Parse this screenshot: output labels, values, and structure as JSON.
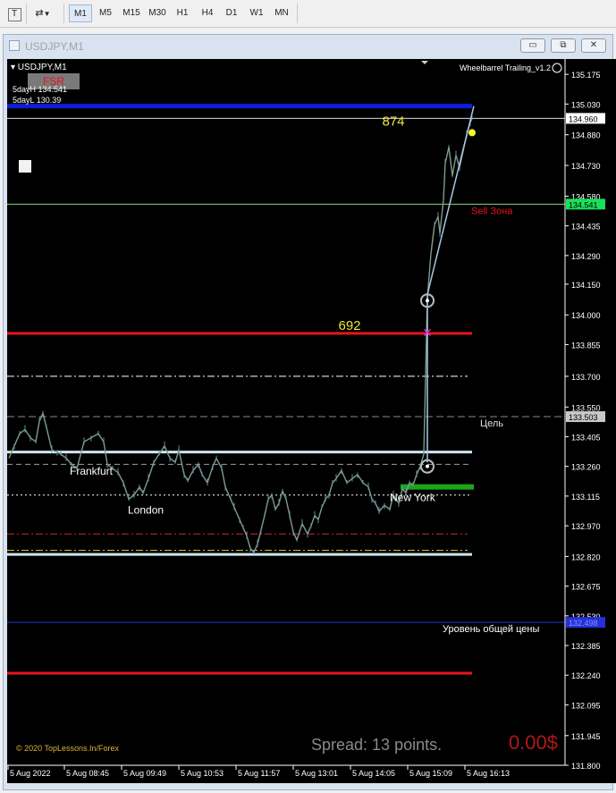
{
  "toolbar": {
    "timeframes": [
      "M1",
      "M5",
      "M15",
      "M30",
      "H1",
      "H4",
      "D1",
      "W1",
      "MN"
    ],
    "active_timeframe": "M1"
  },
  "window": {
    "title": "USDJPY,M1",
    "minimize": "▭",
    "restore": "⧉",
    "close": "✕"
  },
  "chart_header": {
    "symbol": "USDJPY,M1",
    "fsr": "FSR",
    "day_high": "5dayH 134.541",
    "day_low": "5dayL 130.39",
    "indicator": "Wheelbarrel Trailing_v1.2"
  },
  "labels": {
    "top_count": "874",
    "mid_count": "692",
    "sell_zone": "Sell Зона",
    "target": "Цель",
    "total_price": "Уровень общей цены",
    "session_frankfurt": "Frankfurt",
    "session_london": "London",
    "session_newyork": "New York",
    "copyright": "© 2020 TopLessons.In/Forex",
    "spread": "Spread: 13 points.",
    "profit": "0.00$"
  },
  "price_tags": {
    "current": "134.960",
    "sell_zone": "134.541",
    "target": "133.503",
    "total_price": "132.498"
  },
  "colors": {
    "accent_red": "#e8141b",
    "accent_blue": "#0b1fd6",
    "price_green": "#19e05a",
    "bar_color": "#7f9c8a",
    "line_color": "#a8c8e8"
  },
  "chart_data": {
    "type": "line",
    "symbol": "USDJPY",
    "timeframe": "M1",
    "y_axis_ticks": [
      "135.175",
      "135.030",
      "134.880",
      "134.730",
      "134.580",
      "134.435",
      "134.290",
      "134.150",
      "134.000",
      "133.855",
      "133.700",
      "133.550",
      "133.405",
      "133.260",
      "133.115",
      "132.970",
      "132.820",
      "132.675",
      "132.530",
      "132.385",
      "132.240",
      "132.095",
      "131.945",
      "131.800"
    ],
    "x_axis_ticks": [
      "5 Aug 2022",
      "5 Aug 08:45",
      "5 Aug 09:49",
      "5 Aug 10:53",
      "5 Aug 11:57",
      "5 Aug 13:01",
      "5 Aug 14:05",
      "5 Aug 15:09",
      "5 Aug 16:13"
    ],
    "ylim": [
      131.8,
      135.25
    ],
    "price_series": [
      [
        0,
        133.3
      ],
      [
        6,
        133.36
      ],
      [
        12,
        133.42
      ],
      [
        18,
        133.44
      ],
      [
        24,
        133.4
      ],
      [
        30,
        133.38
      ],
      [
        34,
        133.48
      ],
      [
        38,
        133.52
      ],
      [
        42,
        133.45
      ],
      [
        48,
        133.34
      ],
      [
        54,
        133.33
      ],
      [
        58,
        133.32
      ],
      [
        64,
        133.3
      ],
      [
        70,
        133.27
      ],
      [
        76,
        133.25
      ],
      [
        84,
        133.38
      ],
      [
        92,
        133.4
      ],
      [
        100,
        133.42
      ],
      [
        106,
        133.38
      ],
      [
        110,
        133.27
      ],
      [
        116,
        133.25
      ],
      [
        122,
        133.23
      ],
      [
        128,
        133.18
      ],
      [
        134,
        133.1
      ],
      [
        140,
        133.12
      ],
      [
        146,
        133.16
      ],
      [
        150,
        133.13
      ],
      [
        156,
        133.2
      ],
      [
        162,
        133.28
      ],
      [
        168,
        133.32
      ],
      [
        174,
        133.36
      ],
      [
        180,
        133.3
      ],
      [
        186,
        133.28
      ],
      [
        190,
        133.34
      ],
      [
        196,
        133.22
      ],
      [
        200,
        133.19
      ],
      [
        206,
        133.24
      ],
      [
        212,
        133.27
      ],
      [
        216,
        133.22
      ],
      [
        222,
        133.18
      ],
      [
        228,
        133.26
      ],
      [
        232,
        133.3
      ],
      [
        238,
        133.25
      ],
      [
        242,
        133.16
      ],
      [
        248,
        133.1
      ],
      [
        252,
        133.06
      ],
      [
        258,
        133.0
      ],
      [
        262,
        132.96
      ],
      [
        266,
        132.92
      ],
      [
        270,
        132.86
      ],
      [
        274,
        132.84
      ],
      [
        278,
        132.88
      ],
      [
        282,
        132.95
      ],
      [
        286,
        133.02
      ],
      [
        290,
        133.1
      ],
      [
        294,
        133.12
      ],
      [
        298,
        133.05
      ],
      [
        302,
        133.08
      ],
      [
        306,
        133.14
      ],
      [
        310,
        133.1
      ],
      [
        314,
        133.02
      ],
      [
        318,
        132.94
      ],
      [
        322,
        132.9
      ],
      [
        328,
        132.98
      ],
      [
        334,
        132.93
      ],
      [
        338,
        132.97
      ],
      [
        342,
        133.02
      ],
      [
        346,
        133.0
      ],
      [
        350,
        133.06
      ],
      [
        354,
        133.1
      ],
      [
        358,
        133.12
      ],
      [
        362,
        133.18
      ],
      [
        366,
        133.2
      ],
      [
        372,
        133.24
      ],
      [
        378,
        133.18
      ],
      [
        384,
        133.2
      ],
      [
        390,
        133.22
      ],
      [
        396,
        133.18
      ],
      [
        402,
        133.16
      ],
      [
        406,
        133.1
      ],
      [
        410,
        133.08
      ],
      [
        414,
        133.04
      ],
      [
        420,
        133.07
      ],
      [
        426,
        133.05
      ],
      [
        430,
        133.12
      ],
      [
        436,
        133.08
      ],
      [
        440,
        133.15
      ],
      [
        444,
        133.13
      ],
      [
        448,
        133.18
      ],
      [
        452,
        133.17
      ],
      [
        456,
        133.22
      ],
      [
        460,
        133.26
      ],
      [
        464,
        133.32
      ],
      [
        468,
        134.08
      ],
      [
        472,
        134.3
      ],
      [
        476,
        134.44
      ],
      [
        480,
        134.48
      ],
      [
        482,
        134.4
      ],
      [
        486,
        134.56
      ],
      [
        488,
        134.74
      ],
      [
        492,
        134.82
      ],
      [
        496,
        134.68
      ],
      [
        500,
        134.78
      ],
      [
        504,
        134.72
      ],
      [
        508,
        134.8
      ],
      [
        512,
        134.88
      ],
      [
        516,
        134.94
      ],
      [
        518,
        134.96
      ]
    ],
    "levels": {
      "blue_top": 135.02,
      "white_current": 134.96,
      "sell_zone": 134.541,
      "red_692": 133.91,
      "dash_dot_white": 133.7,
      "target": 133.503,
      "light_blue_upper": 133.33,
      "dash_gray": 133.27,
      "green_bar": 133.16,
      "dotted_white": 133.12,
      "dash_red": 132.93,
      "dash_yellow": 132.85,
      "light_blue_lower": 132.83,
      "blue_total": 132.498,
      "red_low": 132.25
    }
  }
}
